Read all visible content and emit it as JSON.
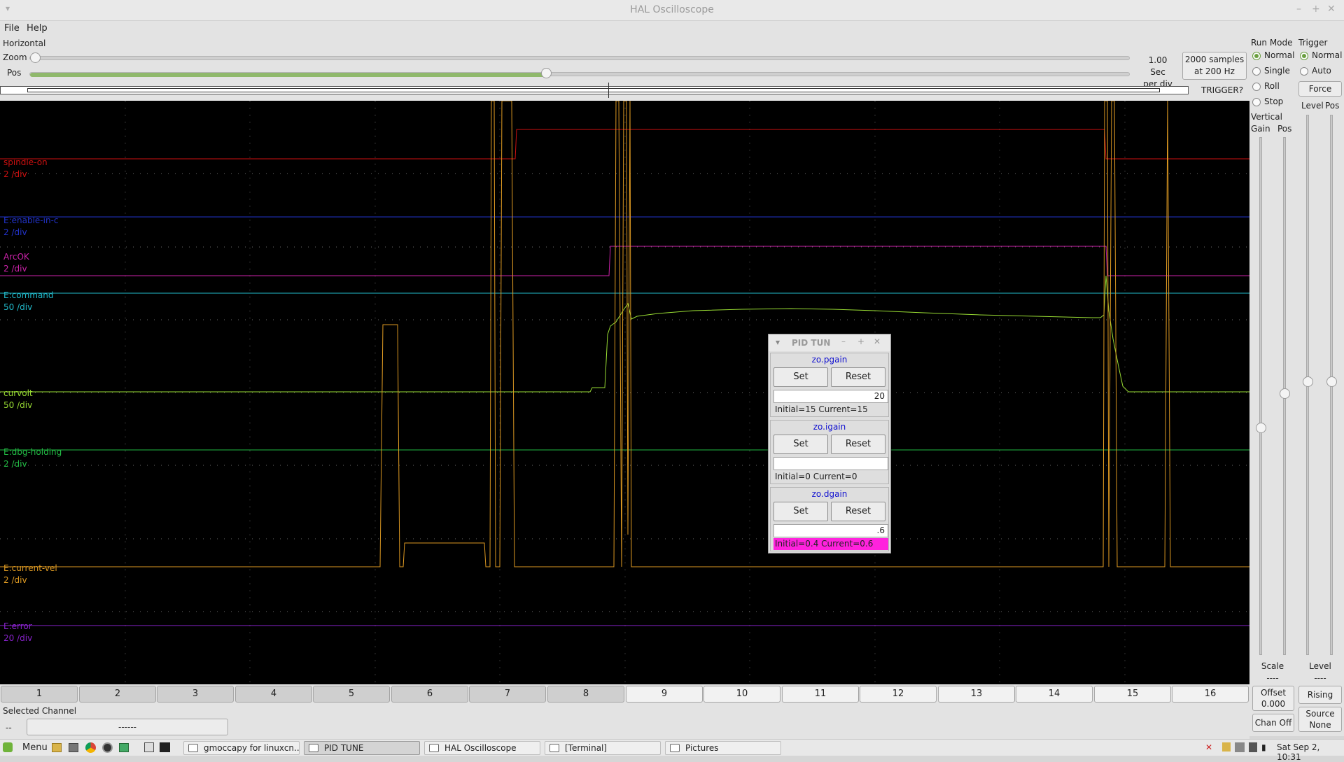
{
  "window": {
    "title": "HAL Oscilloscope"
  },
  "menu": {
    "file": "File",
    "help": "Help"
  },
  "horizontal": {
    "section_label": "Horizontal",
    "zoom_label": "Zoom",
    "pos_label": "Pos",
    "zoom_value": 0.0,
    "pos_value": 0.47,
    "scale_line1": "1.00 Sec",
    "scale_line2": "per div",
    "samples_line1": "2000 samples",
    "samples_line2": "at 200 Hz",
    "trigger_status": "TRIGGER?"
  },
  "run_mode": {
    "label": "Run Mode",
    "options": [
      "Normal",
      "Single",
      "Roll",
      "Stop"
    ],
    "selected": "Normal"
  },
  "trigger": {
    "label": "Trigger",
    "options": [
      "Normal",
      "Auto"
    ],
    "selected": "Normal",
    "force_label": "Force",
    "level_label": "Level",
    "pos_label": "Pos",
    "level_bottom_label": "Level",
    "level_value": "----",
    "rising_label": "Rising",
    "source_line1": "Source",
    "source_line2": "None"
  },
  "vertical": {
    "label": "Vertical",
    "gain_label": "Gain",
    "pos_label": "Pos",
    "scale_label": "Scale",
    "scale_value": "----",
    "offset_label": "Offset",
    "offset_value": "0.000",
    "chan_off_label": "Chan Off"
  },
  "channels": [
    {
      "name": "spindle-on",
      "scale": "2 /div",
      "color": "#cc1010"
    },
    {
      "name": "E:enable-in-c",
      "scale": "2 /div",
      "color": "#2233cc"
    },
    {
      "name": "ArcOK",
      "scale": "2 /div",
      "color": "#cc22aa"
    },
    {
      "name": "E:command",
      "scale": "50 /div",
      "color": "#22bbcc"
    },
    {
      "name": "curvolt",
      "scale": "50 /div",
      "color": "#99dd33"
    },
    {
      "name": "E:dbg-holding",
      "scale": "2 /div",
      "color": "#22bb44"
    },
    {
      "name": "E:current-vel",
      "scale": "2 /div",
      "color": "#dd9922"
    },
    {
      "name": "E:error",
      "scale": "20 /div",
      "color": "#8822cc"
    }
  ],
  "channel_buttons": [
    "1",
    "2",
    "3",
    "4",
    "5",
    "6",
    "7",
    "8",
    "9",
    "10",
    "11",
    "12",
    "13",
    "14",
    "15",
    "16"
  ],
  "selected_channel": {
    "label": "Selected Channel",
    "value": "--",
    "field": "------"
  },
  "pid_tune": {
    "title": "PID TUN",
    "set_label": "Set",
    "reset_label": "Reset",
    "params": [
      {
        "name": "zo.pgain",
        "entry": "20",
        "status": "Initial=15 Current=15",
        "highlight": false
      },
      {
        "name": "zo.igain",
        "entry": "",
        "status": "Initial=0 Current=0",
        "highlight": false
      },
      {
        "name": "zo.dgain",
        "entry": ".6",
        "status": "Initial=0.4 Current=0.6",
        "highlight": true
      }
    ]
  },
  "taskbar": {
    "menu_label": "Menu",
    "tasks": [
      {
        "label": "gmoccapy for linuxcn...",
        "active": false
      },
      {
        "label": "PID TUNE",
        "active": true
      },
      {
        "label": "HAL Oscilloscope",
        "active": false
      },
      {
        "label": "[Terminal]",
        "active": false
      },
      {
        "label": "Pictures",
        "active": false
      }
    ],
    "clock": "Sat Sep 2, 10:31"
  }
}
